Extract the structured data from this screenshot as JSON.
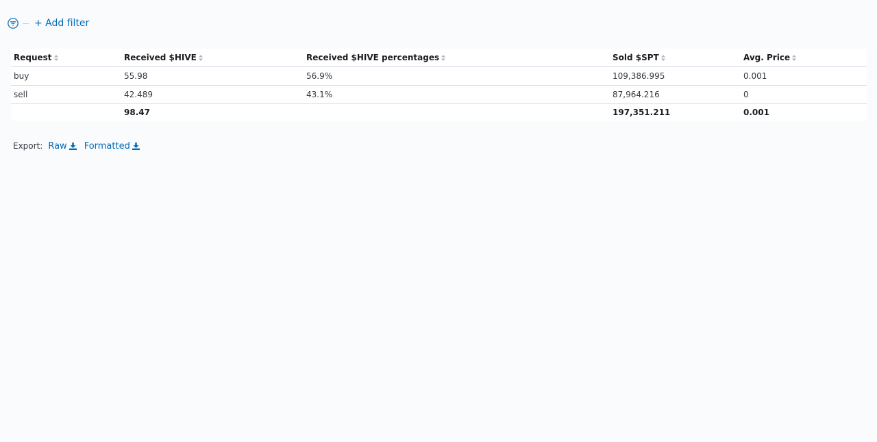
{
  "filter_bar": {
    "add_filter_label": "+ Add filter"
  },
  "table": {
    "headers": [
      "Request",
      "Received $HIVE",
      "Received $HIVE percentages",
      "Sold $SPT",
      "Avg. Price"
    ],
    "rows": [
      [
        "buy",
        "55.98",
        "56.9%",
        "109,386.995",
        "0.001"
      ],
      [
        "sell",
        "42.489",
        "43.1%",
        "87,964.216",
        "0"
      ]
    ],
    "totals": [
      "",
      "98.47",
      "",
      "197,351.211",
      "0.001"
    ]
  },
  "export": {
    "label": "Export:",
    "raw_label": "Raw",
    "formatted_label": "Formatted"
  },
  "colors": {
    "link": "#006bb8",
    "border": "#d3dae6",
    "background": "#fafbfd"
  }
}
